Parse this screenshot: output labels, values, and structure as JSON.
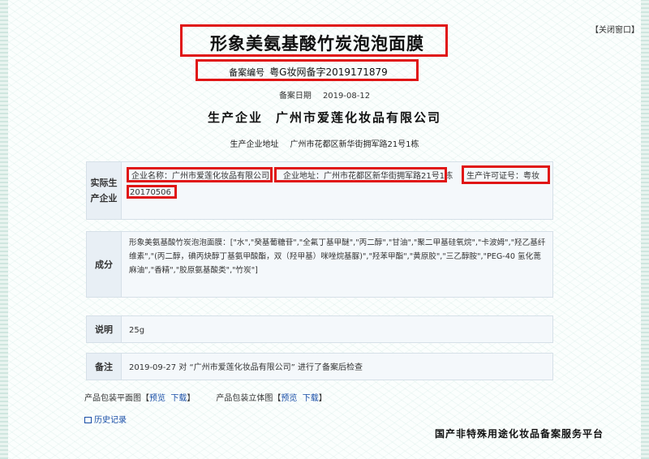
{
  "header": {
    "close_label": "【关闭窗口】"
  },
  "product": {
    "name": "形象美氨基酸竹炭泡泡面膜",
    "record_no_label": "备案编号",
    "record_no": "粤G妆网备字2019171879",
    "record_date_label": "备案日期",
    "record_date": "2019-08-12",
    "company_label": "生产企业",
    "company_name": "广州市爱莲化妆品有限公司",
    "company_addr_label": "生产企业地址",
    "company_addr": "广州市花都区新华街拥军路21号1栋"
  },
  "actual_producer": {
    "label": "实际生产企业",
    "name_field": "企业名称：广州市爱莲化妆品有限公司",
    "addr_field": "企业地址：广州市花都区新华街拥军路21号1栋",
    "license_field": "生产许可证号：粤妆",
    "license_no": "20170506"
  },
  "ingredients": {
    "label": "成分",
    "text": "形象美氨基酸竹炭泡泡面膜：[\"水\",\"癸基葡糖苷\",\"全氟丁基甲醚\",\"丙二醇\",\"甘油\",\"聚二甲基硅氧烷\",\"卡波姆\",\"羟乙基纤维素\",\"(丙二醇，碘丙炔醇丁基氨甲酸酯，双（羟甲基）咪唑烷基脲)\",\"羟苯甲酯\",\"黄原胶\",\"三乙醇胺\",\"PEG-40 氢化蓖麻油\",\"香精\",\"胶原氨基酸类\",\"竹炭\"]"
  },
  "description": {
    "label": "说明",
    "text": "25g"
  },
  "notes": {
    "label": "备注",
    "text": "2019-09-27 对 “广州市爱莲化妆品有限公司” 进行了备案后检查"
  },
  "links": {
    "flat_label": "产品包装平面图",
    "solid_label": "产品包装立体图",
    "bracket_open": "【",
    "bracket_close": "】",
    "preview": "预览",
    "download": "下载",
    "history": "历史记录"
  },
  "footer": {
    "watermark": "国产非特殊用途化妆品备案服务平台"
  },
  "colors": {
    "annotation_red": "#e01515",
    "link_blue": "#1a4fa8"
  }
}
